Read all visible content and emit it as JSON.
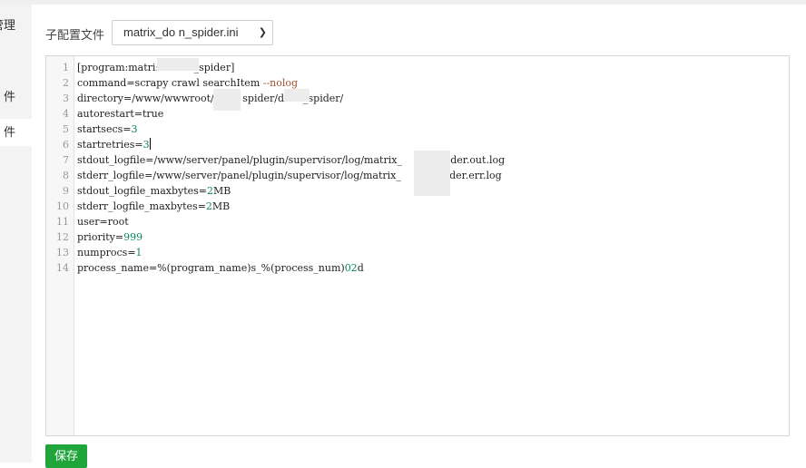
{
  "sidebar": {
    "items": [
      {
        "label": "管理"
      },
      {
        "label": "件"
      },
      {
        "label": "件"
      }
    ]
  },
  "config": {
    "label": "子配置文件",
    "selected_file": "matrix_do    n_spider.ini"
  },
  "editor": {
    "lines": [
      {
        "n": "1",
        "text": "[program:matri:           _spider]"
      },
      {
        "n": "2",
        "text": "command=scrapy crawl searchItem --nolog"
      },
      {
        "n": "3",
        "text": "directory=/www/wwwroot/d       spider/d      _spider/"
      },
      {
        "n": "4",
        "text": "autorestart=true"
      },
      {
        "n": "5",
        "text": "startsecs=3"
      },
      {
        "n": "6",
        "text": "startretries=3"
      },
      {
        "n": "7",
        "text": "stdout_logfile=/www/server/panel/plugin/supervisor/log/matrix_       n_spider.out.log"
      },
      {
        "n": "8",
        "text": "stderr_logfile=/www/server/panel/plugin/supervisor/log/matrix_       n_spider.err.log"
      },
      {
        "n": "9",
        "text": "stdout_logfile_maxbytes=2MB"
      },
      {
        "n": "10",
        "text": "stderr_logfile_maxbytes=2MB"
      },
      {
        "n": "11",
        "text": "user=root"
      },
      {
        "n": "12",
        "text": "priority=999"
      },
      {
        "n": "13",
        "text": "numprocs=1"
      },
      {
        "n": "14",
        "text": "process_name=%(program_name)s_%(process_num)02d"
      }
    ]
  },
  "actions": {
    "save_label": "保存"
  },
  "colors": {
    "accent": "#20a53a",
    "number": "#098658",
    "keyword": "#a0522d"
  }
}
